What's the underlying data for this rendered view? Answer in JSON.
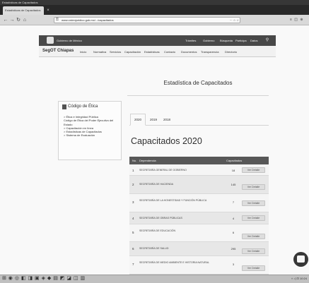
{
  "os": {
    "top_text": "Estadísticas de Capacitados"
  },
  "browser": {
    "tab_title": "Estadísticas de Capacitados",
    "tab_close": "×",
    "url": "www.ordenjuridico.gob.mx/.../capacitados",
    "zoom": "··· ☆ ☆",
    "ext": "≡ ◫ ⊕"
  },
  "site": {
    "org": "Gobierno de México",
    "top_nav": [
      "Trámites",
      "Gobierno",
      "Búsqueda",
      "Participa",
      "Datos"
    ],
    "brand": "SegOT Chiapas",
    "sub_nav": [
      "Inicio",
      "Normativa",
      "Servicios",
      "Capacitación",
      "Estadísticas",
      "Contacto",
      "Documentos",
      "Transparencia",
      "Directorio"
    ]
  },
  "sidebar": {
    "title": "Código de Ética",
    "items": [
      "> Ética e Integridad Pública",
      "Código de Ética del Poder Ejecutivo del",
      "Estado",
      "> Capacitación en línea",
      "> Estadísticas de Capacitados",
      "> Sistema de Evaluación"
    ]
  },
  "content": {
    "title": "Estadística de Capacitados",
    "year_tabs": [
      "2020",
      "2019",
      "2018"
    ],
    "section_heading": "Capacitados 2020",
    "table_headers": [
      "No.",
      "Dependencia",
      "Capacitados",
      ""
    ],
    "rows": [
      {
        "num": "1",
        "name": "SECRETARÍA GENERAL DE GOBIERNO",
        "val": "18",
        "btn": "Ver Detalle"
      },
      {
        "num": "2",
        "name": "SECRETARÍA DE HACIENDA",
        "val": "145",
        "btn": "Ver Detalle"
      },
      {
        "num": "3",
        "name": "SECRETARÍA DE LA HONESTIDAD Y FUNCIÓN PÚBLICA",
        "val": "7",
        "btn": "Ver Detalle"
      },
      {
        "num": "4",
        "name": "SECRETARÍA DE OBRAS PÚBLICAS",
        "val": "4",
        "btn": "Ver Detalle"
      },
      {
        "num": "5",
        "name": "SECRETARÍA DE EDUCACIÓN",
        "val": "6",
        "btn": "Ver Detalle"
      },
      {
        "num": "6",
        "name": "SECRETARÍA DE SALUD",
        "val": "295",
        "btn": "Ver Detalle"
      },
      {
        "num": "7",
        "name": "SECRETARÍA DE MEDIO AMBIENTE E HISTORIA NATURAL",
        "val": "3",
        "btn": "Ver Detalle"
      }
    ]
  },
  "taskbar": {
    "icons": "⊞ ◉ ◎ ◧ ◨ ▣ ◈ ◆ ▤ ◩ ◪ ◫ ▥",
    "tray": "˄ ◁ ⊡ 10:24"
  }
}
